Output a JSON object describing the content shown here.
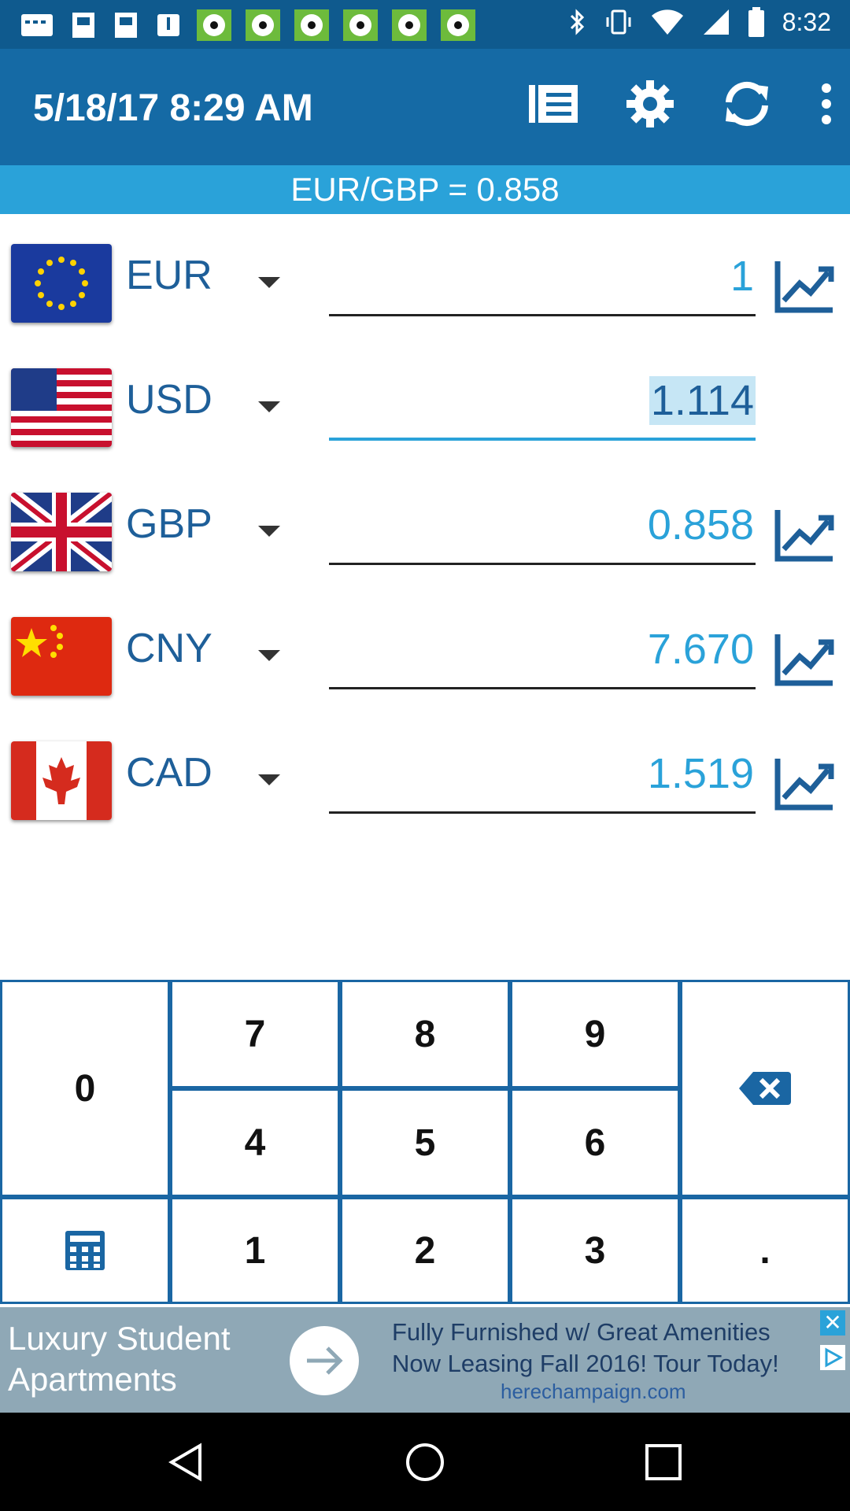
{
  "status": {
    "time": "8:32",
    "notification_icons": [
      "calendar-icon",
      "flipboard-icon",
      "flipboard-icon",
      "calendar-icon",
      "soccer-icon",
      "soccer-icon",
      "soccer-icon",
      "soccer-icon",
      "soccer-icon",
      "soccer-icon"
    ],
    "system_icons": [
      "bluetooth-icon",
      "vibrate-icon",
      "wifi-icon",
      "signal-icon",
      "battery-icon"
    ]
  },
  "header": {
    "title": "5/18/17 8:29 AM",
    "actions": [
      "notes-icon",
      "settings-icon",
      "refresh-icon",
      "more-icon"
    ]
  },
  "rate": {
    "text": "EUR/GBP = 0.858"
  },
  "currencies": [
    {
      "code": "EUR",
      "value": "1",
      "flag": "eu-flag-icon",
      "active": false,
      "chart": true
    },
    {
      "code": "USD",
      "value": "1.114",
      "flag": "us-flag-icon",
      "active": true,
      "chart": false
    },
    {
      "code": "GBP",
      "value": "0.858",
      "flag": "uk-flag-icon",
      "active": false,
      "chart": true
    },
    {
      "code": "CNY",
      "value": "7.670",
      "flag": "cn-flag-icon",
      "active": false,
      "chart": true
    },
    {
      "code": "CAD",
      "value": "1.519",
      "flag": "ca-flag-icon",
      "active": false,
      "chart": true
    }
  ],
  "keypad": {
    "k0": "0",
    "k1": "1",
    "k2": "2",
    "k3": "3",
    "k4": "4",
    "k5": "5",
    "k6": "6",
    "k7": "7",
    "k8": "8",
    "k9": "9",
    "dot": "."
  },
  "ad": {
    "headline_line1": "Luxury Student",
    "headline_line2": "Apartments",
    "body_line1": "Fully Furnished w/ Great Amenities",
    "body_line2": "Now Leasing Fall 2016! Tour Today!",
    "url": "herechampaign.com",
    "close": "✕"
  },
  "colors": {
    "status_bar": "#0f5a8e",
    "app_bar": "#156aa5",
    "accent": "#2aa2d9",
    "code_text": "#1e5f99"
  }
}
